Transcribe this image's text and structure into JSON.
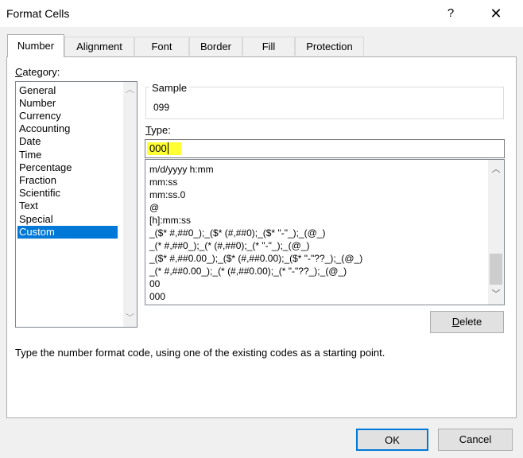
{
  "window": {
    "title": "Format Cells",
    "help_label": "?",
    "close_label": "✕"
  },
  "tabs": [
    "Number",
    "Alignment",
    "Font",
    "Border",
    "Fill",
    "Protection"
  ],
  "category": {
    "label": "Category:",
    "items": [
      "General",
      "Number",
      "Currency",
      "Accounting",
      "Date",
      "Time",
      "Percentage",
      "Fraction",
      "Scientific",
      "Text",
      "Special",
      "Custom"
    ],
    "selected": "Custom"
  },
  "sample": {
    "label": "Sample",
    "value": "099"
  },
  "type": {
    "label": "Type:",
    "value": "000",
    "formats": [
      "m/d/yyyy h:mm",
      "mm:ss",
      "mm:ss.0",
      "@",
      "[h]:mm:ss",
      "_($* #,##0_);_($* (#,##0);_($* \"-\"_);_(@_)",
      "_(* #,##0_);_(* (#,##0);_(* \"-\"_);_(@_)",
      "_($* #,##0.00_);_($* (#,##0.00);_($* \"-\"??_);_(@_)",
      "_(* #,##0.00_);_(* (#,##0.00);_(* \"-\"??_);_(@_)",
      "00",
      "000"
    ]
  },
  "buttons": {
    "delete": "Delete",
    "ok": "OK",
    "cancel": "Cancel"
  },
  "hint": "Type the number format code, using one of the existing codes as a starting point.",
  "colors": {
    "selection": "#0078d7",
    "highlight": "#ffff33",
    "default_button_border": "#0078d7"
  }
}
